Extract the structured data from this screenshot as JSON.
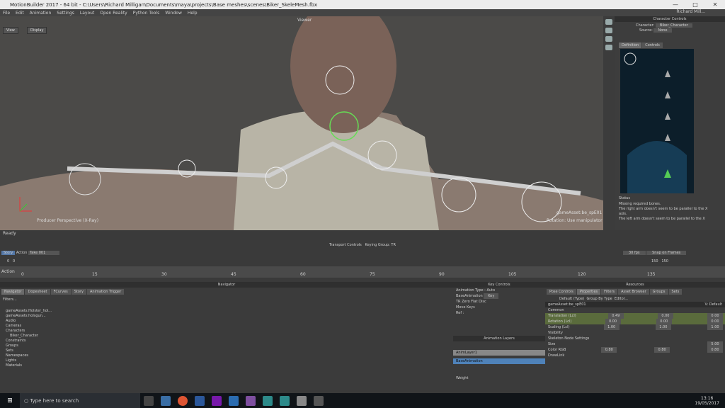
{
  "window": {
    "title": "MotionBuilder 2017  -  64 bit  -  C:\\Users\\Richard Milligan\\Documents\\maya\\projects\\Base meshes\\scenes\\Biker_SkeleMesh.fbx",
    "user": "Richard Mill..."
  },
  "menu": [
    "File",
    "Edit",
    "Animation",
    "Settings",
    "Layout",
    "Open Reality",
    "Python Tools",
    "Window",
    "Help"
  ],
  "viewer": {
    "title": "Viewer",
    "view_btn": "View",
    "display_btn": "Display",
    "perspective": "Producer Perspective (X-Ray)",
    "selected": "gameAsset:be_spE01",
    "rotation": "Rotation: Use manipulator",
    "status": "Ready"
  },
  "character_controls": {
    "title": "Character Controls",
    "character_label": "Character:",
    "character_value": "Biker_Character",
    "source_label": "Source:",
    "source_value": "None",
    "tab_definition": "Definition",
    "tab_controls": "Controls",
    "status_label": "Status",
    "status_lines": [
      "Missing required bones.",
      "The right arm doesn't seem to be parallel to the X",
      "axis.",
      "The left arm doesn't seem to be parallel to the X"
    ]
  },
  "transport": {
    "title": "Transport Controls",
    "keying": "Keying Group: TR",
    "story": "Story",
    "action": "Action",
    "take": "Take 001",
    "frame_a": "0",
    "frame_b": "0",
    "fps": "30 fps",
    "snap": "Snap on Frames",
    "end": "150",
    "end2": "150"
  },
  "timeline": {
    "label": "Action",
    "ticks": [
      "0",
      "15",
      "30",
      "45",
      "60",
      "75",
      "90",
      "105",
      "120",
      "135"
    ]
  },
  "navigator": {
    "title": "Navigator",
    "tabs": [
      "Navigator",
      "Dopesheet",
      "FCurves",
      "Story",
      "Animation Trigger"
    ],
    "filter": "Filters...",
    "tree": [
      "gameAssets:Holster_hol...",
      "gameAssets:holsgun...",
      "Audio",
      "Cameras",
      "Characters",
      "Biker_Character",
      "Constraints",
      "Groups",
      "Sets",
      "Namespaces",
      "Lights",
      "Materials"
    ]
  },
  "key_controls": {
    "title": "Key Controls",
    "animation": "Animation",
    "type_label": "Type :",
    "type_value": "Auto",
    "base_animation": "BaseAnimation",
    "key": "Key",
    "tr": "TR",
    "zero": "Zero",
    "flat": "Flat",
    "disc": "Disc",
    "move_keys": "Move Keys",
    "ref": "Ref :",
    "layers_title": "Animation Layers",
    "layer1": "AnimLayer1",
    "layer_base": "BaseAnimation",
    "weight": "Weight"
  },
  "resources": {
    "title": "Resources",
    "tabs": [
      "Pose Controls",
      "Properties",
      "Filters",
      "Asset Browser",
      "Groups",
      "Sets"
    ],
    "default_type": "Default (Type)",
    "group_by": "Group By Type",
    "editor": "Editor...",
    "object": "gameAsset:be_spE01",
    "view": "V: Default",
    "common": "Common",
    "props": [
      {
        "name": "Translation (Lcl)",
        "v": [
          "0.49",
          "0.00",
          "0.00"
        ]
      },
      {
        "name": "Rotation (Lcl)",
        "v": [
          "0.00",
          "0.00",
          "0.00"
        ]
      },
      {
        "name": "Scaling (Lcl)",
        "v": [
          "1.00",
          "1.00",
          "1.00"
        ]
      }
    ],
    "visibility": "Visibility",
    "skel_settings": "Skeleton Node Settings",
    "size": "Size",
    "size_v": "5.00",
    "color": "Color RGB",
    "color_v": [
      "0.80",
      "0.80",
      "0.80"
    ],
    "drawlink": "DrawLink"
  },
  "taskbar": {
    "search": "Type here to search",
    "time": "13:16",
    "date": "19/05/2017"
  }
}
